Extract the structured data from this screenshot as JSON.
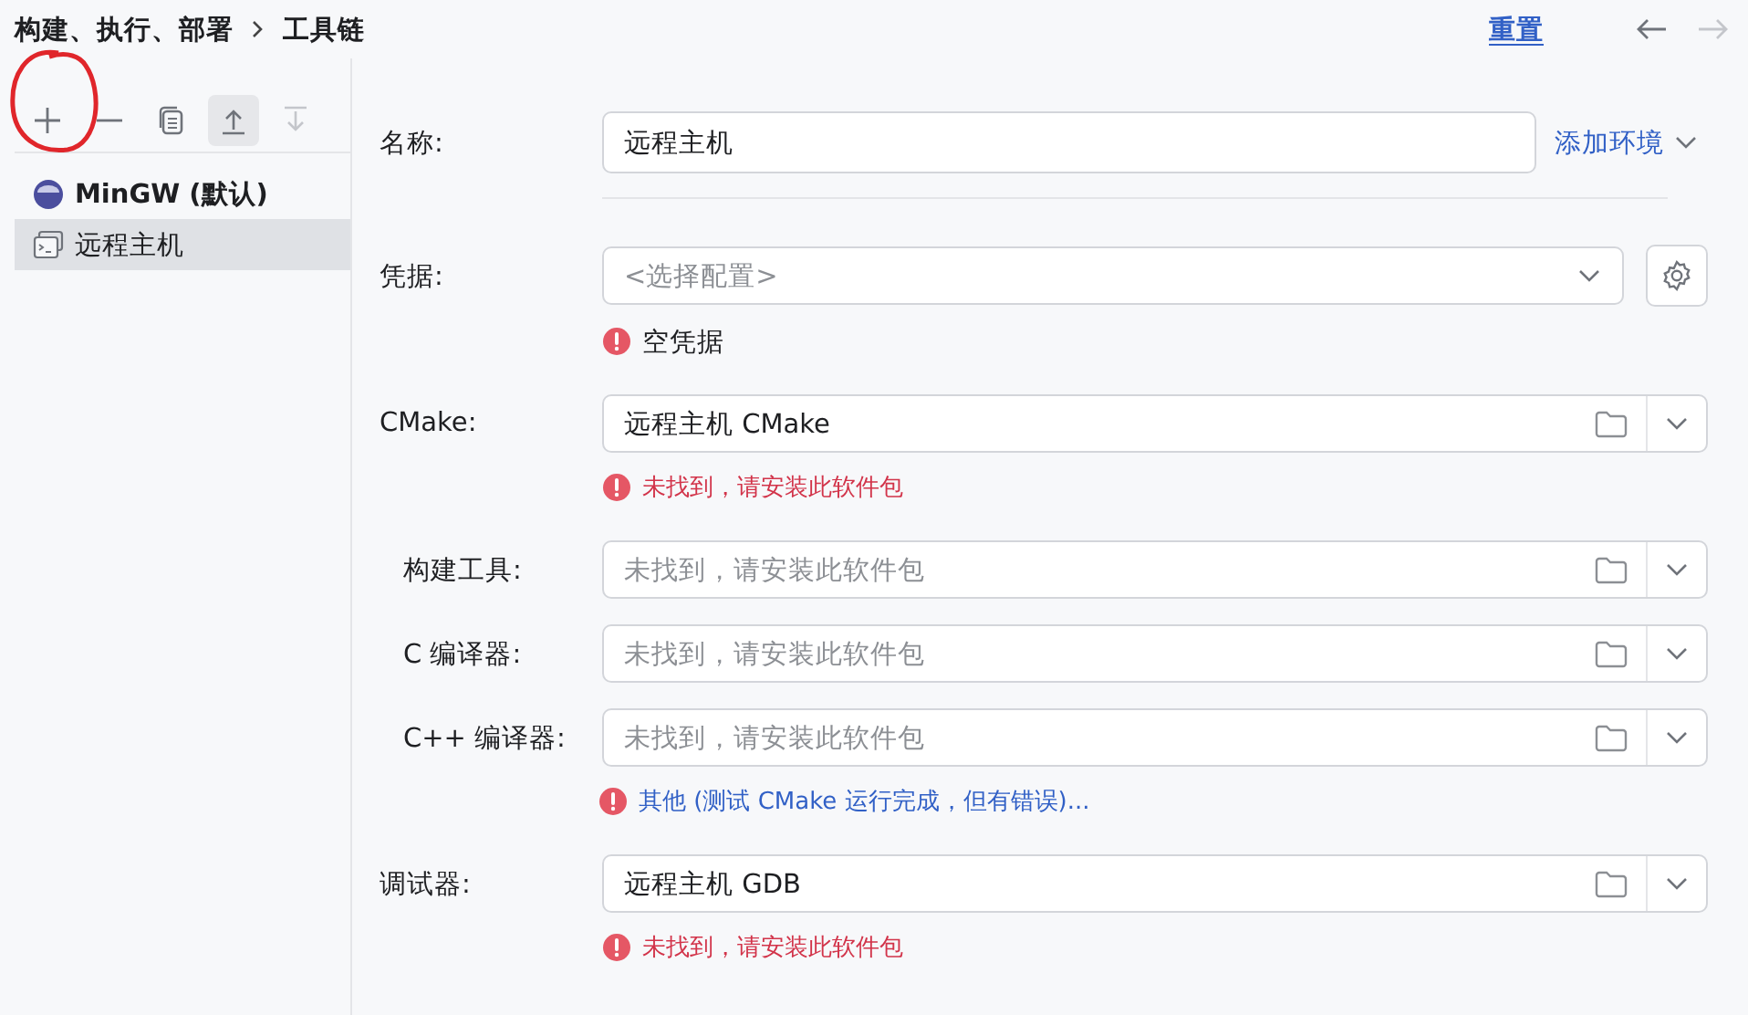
{
  "header": {
    "breadcrumb": [
      {
        "label": "构建、执行、部署"
      },
      {
        "label": "工具链"
      }
    ],
    "reset_link": "重置",
    "nav": [
      {
        "kind": "back",
        "disabled": false
      },
      {
        "kind": "forward",
        "disabled": true
      }
    ]
  },
  "toolbar": [
    {
      "kind": "add",
      "disabled": false,
      "hovered": false
    },
    {
      "kind": "remove",
      "disabled": false,
      "hovered": false
    },
    {
      "kind": "copy",
      "disabled": false,
      "hovered": false
    },
    {
      "kind": "move_up",
      "disabled": false,
      "hovered": true
    },
    {
      "kind": "move_down",
      "disabled": true,
      "hovered": false
    }
  ],
  "toolchains": [
    {
      "name": "MinGW (默认)",
      "kind": "gnu",
      "default": true,
      "selected": false
    },
    {
      "name": "远程主机",
      "kind": "remote",
      "default": false,
      "selected": true
    }
  ],
  "fields": [
    {
      "kind": "text",
      "label": "名称:",
      "value": "远程主机",
      "indented": false,
      "action": "添加环境",
      "divider_after": true
    },
    {
      "kind": "combo",
      "label": "凭据:",
      "placeholder": "<选择配置>",
      "indented": false,
      "gear": true,
      "message": {
        "text": "空凭据",
        "kind": "plain"
      }
    },
    {
      "kind": "path",
      "label": "CMake:",
      "value": "远程主机 CMake",
      "indented": false,
      "message": {
        "text": "未找到，请安装此软件包",
        "kind": "error"
      }
    },
    {
      "kind": "path",
      "label": "构建工具:",
      "placeholder": "未找到，请安装此软件包",
      "indented": true
    },
    {
      "kind": "path",
      "label": "C 编译器:",
      "placeholder": "未找到，请安装此软件包",
      "indented": true
    },
    {
      "kind": "path",
      "label": "C++ 编译器:",
      "placeholder": "未找到，请安装此软件包",
      "indented": true,
      "message": {
        "text": "其他 (测试 CMake 运行完成，但有错误)...",
        "kind": "link"
      }
    },
    {
      "kind": "path",
      "label": "调试器:",
      "value": "远程主机 GDB",
      "indented": false,
      "message": {
        "text": "未找到，请安装此软件包",
        "kind": "error"
      }
    }
  ]
}
